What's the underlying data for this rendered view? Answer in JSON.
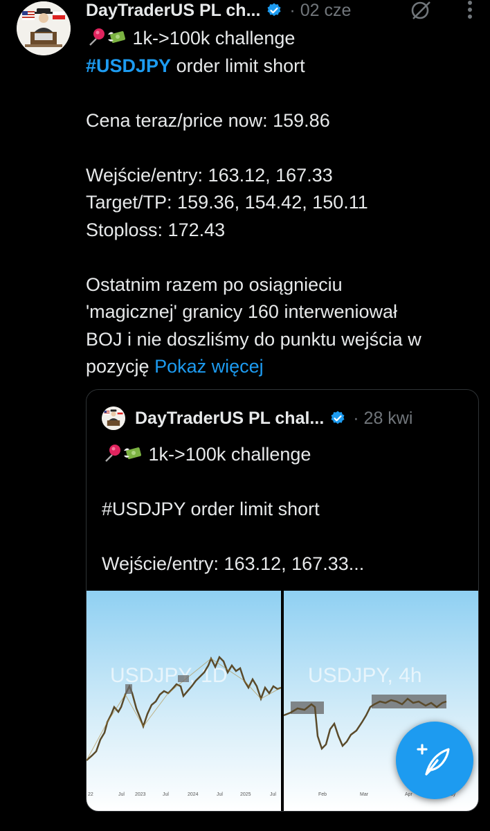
{
  "post": {
    "author_name": "DayTraderUS PL ch...",
    "date": "· 02 cze",
    "lines": [
      "1k->100k challenge",
      "order limit short",
      "",
      "Cena teraz/price now: 159.86",
      "",
      "Wejście/entry: 163.12, 167.33",
      "Target/TP: 159.36, 154.42, 150.11",
      "Stoploss: 172.43",
      "",
      "Ostatnim razem po osiągnieciu",
      "'magicznej' granicy 160 interweniował",
      "BOJ i nie doszliśmy do punktu wejścia w",
      "pozycję"
    ],
    "hashtag": "#USDJPY",
    "show_more": "Pokaż więcej"
  },
  "quote": {
    "author_name": "DayTraderUS PL chal...",
    "date": "· 28 kwi",
    "line1": "1k->100k challenge",
    "line2": "#USDJPY order limit short",
    "line3": "Wejście/entry: 163.12, 167.33...",
    "chart_left": {
      "watermark": "USDJPY, 1D",
      "x_ticks": [
        "22",
        "Jul",
        "2023",
        "Jul",
        "2024",
        "Jul",
        "2025",
        "Jul"
      ]
    },
    "chart_right": {
      "watermark": "USDJPY, 4h",
      "x_ticks": [
        "Feb",
        "Mar",
        "Apr",
        "May"
      ]
    }
  },
  "icons": {
    "verified": "verified-badge-icon",
    "grok": "grok-icon",
    "more": "more-vertical-icon",
    "compose": "compose-post-icon"
  },
  "colors": {
    "accent": "#1d9bf0",
    "background": "#000000",
    "text": "#e7e9ea",
    "muted": "#71767b"
  }
}
